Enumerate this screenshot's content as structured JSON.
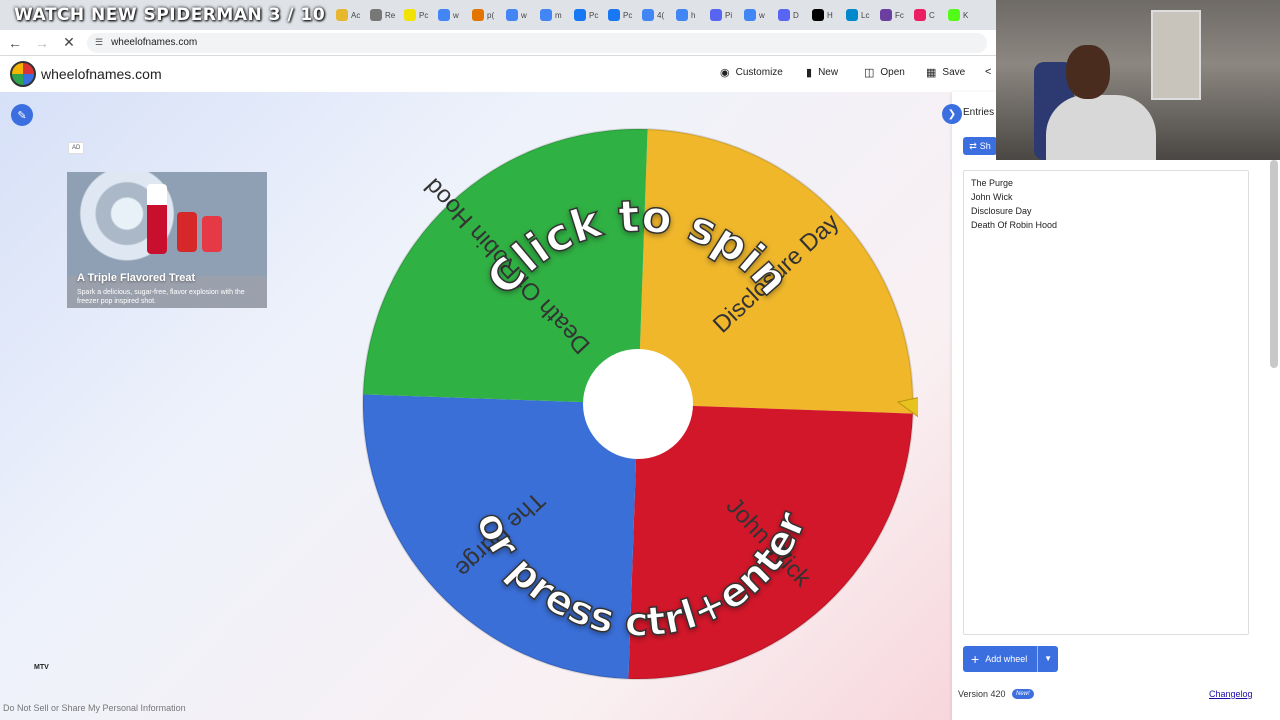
{
  "stream_overlay": {
    "title": "WATCH NEW SPIDERMAN 3 / 10"
  },
  "browser": {
    "tabs": [
      {
        "label": "Ac",
        "color": "#e8b730"
      },
      {
        "label": "Re",
        "color": "#777777"
      },
      {
        "label": "Pc",
        "color": "#f2e200"
      },
      {
        "label": "w",
        "color": "#4285f4"
      },
      {
        "label": "p(",
        "color": "#e37400"
      },
      {
        "label": "w",
        "color": "#4285f4"
      },
      {
        "label": "m",
        "color": "#4285f4"
      },
      {
        "label": "Pc",
        "color": "#1877f2"
      },
      {
        "label": "Pc",
        "color": "#1877f2"
      },
      {
        "label": "4(",
        "color": "#4285f4"
      },
      {
        "label": "h",
        "color": "#4285f4"
      },
      {
        "label": "Pi",
        "color": "#5865f2"
      },
      {
        "label": "w",
        "color": "#4285f4"
      },
      {
        "label": "D",
        "color": "#5865f2"
      },
      {
        "label": "H",
        "color": "#000000"
      },
      {
        "label": "Lc",
        "color": "#0088cc"
      },
      {
        "label": "Fc",
        "color": "#6a3fa0"
      },
      {
        "label": "C",
        "color": "#e91e63"
      },
      {
        "label": "K",
        "color": "#53fc18"
      }
    ],
    "url": "wheelofnames.com"
  },
  "header": {
    "site_name": "wheelofnames.com",
    "customize_label": "Customize",
    "new_label": "New",
    "open_label": "Open",
    "save_label": "Save"
  },
  "ad": {
    "label": "AD",
    "title": "A Triple Flavored Treat",
    "description": "Spark a delicious, sugar-free, flavor explosion with the freezer pop inspired shot."
  },
  "mtv_logo": "MTV",
  "privacy_link": "Do Not Sell or Share My Personal Information",
  "wheel": {
    "prompt_top": "Click to spin",
    "prompt_bottom": "or press ctrl+enter",
    "segments": [
      {
        "label": "Disclosure Day",
        "color": "#f0b72b"
      },
      {
        "label": "John Wick",
        "color": "#d3172a"
      },
      {
        "label": "The Purge",
        "color": "#3a6fd8"
      },
      {
        "label": "Death Of Robin Hood",
        "color": "#30b143"
      }
    ]
  },
  "panel": {
    "tab_entries": "Entries",
    "shuffle_label": "Sh",
    "entries": [
      "The Purge",
      "John Wick",
      "Disclosure Day",
      "Death Of Robin Hood"
    ],
    "add_wheel_label": "Add wheel",
    "version": "Version 420",
    "new_badge": "New!",
    "changelog": "Changelog"
  },
  "colors": {
    "accent": "#3b6fe0"
  }
}
